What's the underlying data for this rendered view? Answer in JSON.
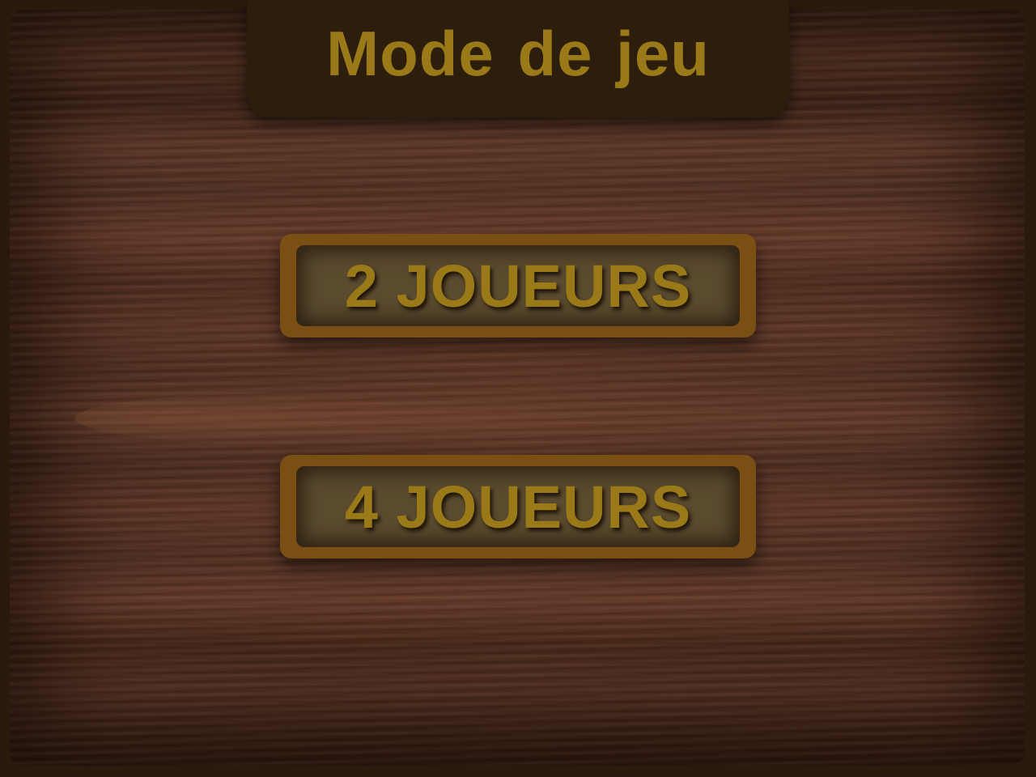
{
  "screen": {
    "title": "Mode de jeu"
  },
  "buttons": {
    "two_players": {
      "label": "2 JOUEURS"
    },
    "four_players": {
      "label": "4 JOUEURS"
    }
  },
  "colors": {
    "frame": "#2a1a0c",
    "banner": "#2c1d0c",
    "text_gold": "#9a7a18",
    "button_border": "#7a4f14",
    "button_fill": "#5a4a2e"
  }
}
